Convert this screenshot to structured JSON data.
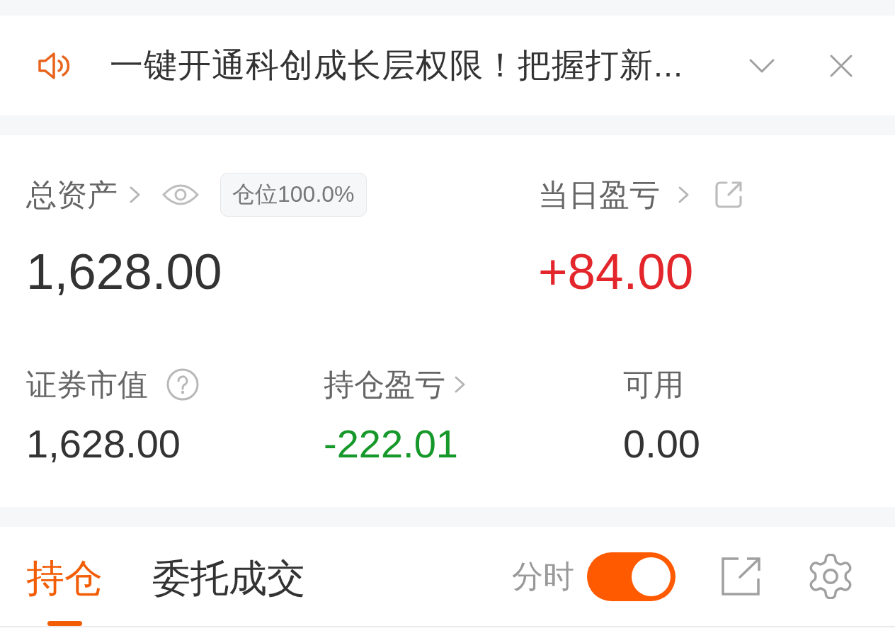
{
  "announcement": {
    "text": "一键开通科创成长层权限！把握打新..."
  },
  "account": {
    "total_assets": {
      "label": "总资产",
      "value": "1,628.00",
      "kind": "neutral",
      "position_tag": "仓位100.0%"
    },
    "daily_pnl": {
      "label": "当日盈亏",
      "value": "+84.00",
      "kind": "gain"
    },
    "stats": [
      {
        "label": "证券市值",
        "value": "1,628.00",
        "kind": "neutral"
      },
      {
        "label": "持仓盈亏",
        "value": "-222.01",
        "kind": "loss"
      },
      {
        "label": "可用",
        "value": "0.00",
        "kind": "neutral"
      }
    ]
  },
  "holdings_bar": {
    "tabs": [
      {
        "label": "持仓",
        "selected": true
      },
      {
        "label": "委托成交",
        "selected": false
      }
    ],
    "intraday_toggle": {
      "label": "分时",
      "on": true
    }
  }
}
